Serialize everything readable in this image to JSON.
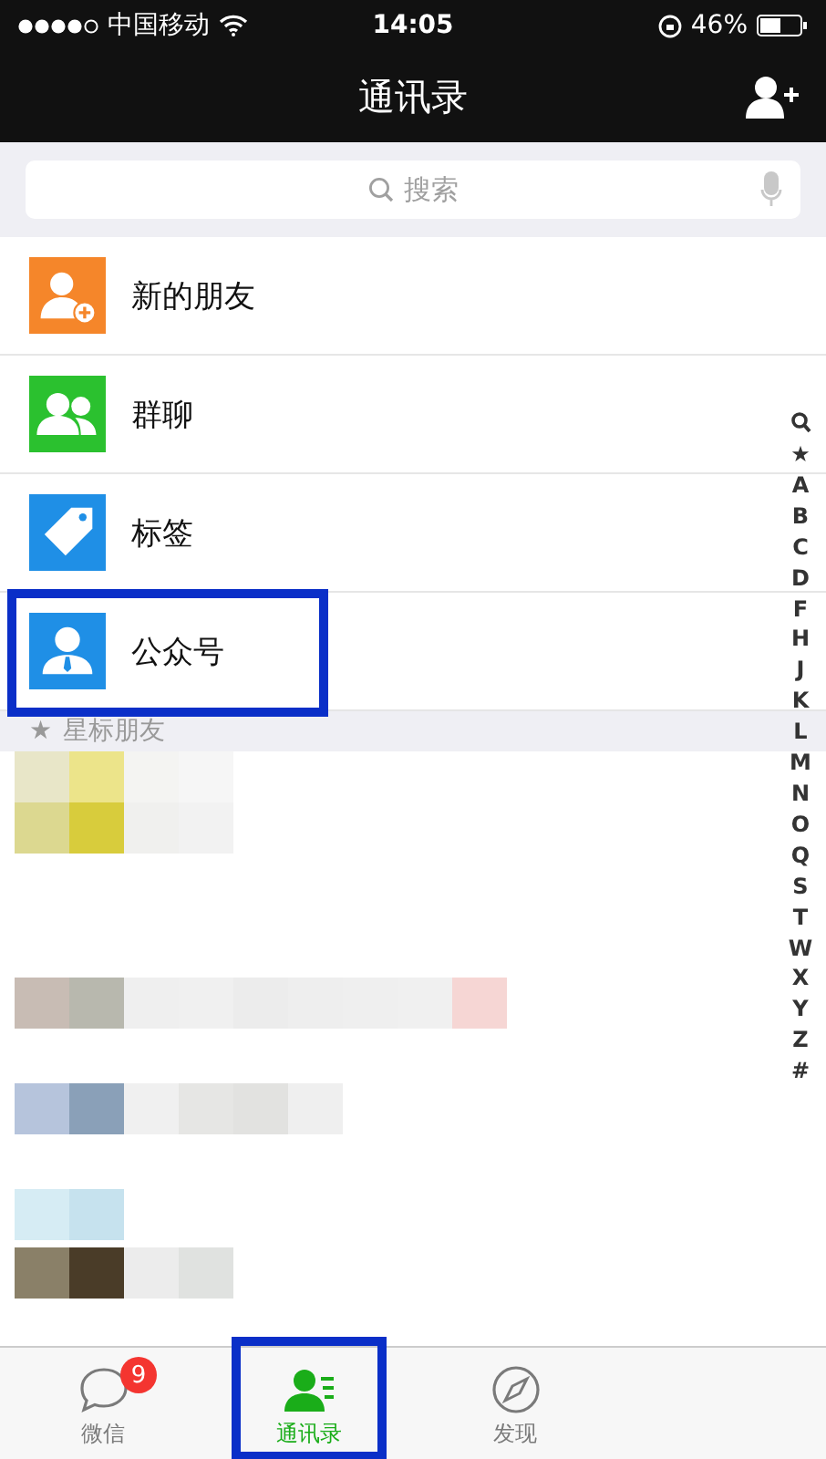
{
  "status_bar": {
    "carrier": "中国移动",
    "time": "14:05",
    "battery": "46%"
  },
  "nav": {
    "title": "通讯录"
  },
  "search": {
    "placeholder": "搜索"
  },
  "entries": [
    {
      "label": "新的朋友",
      "kind": "new-friends",
      "highlighted": false
    },
    {
      "label": "群聊",
      "kind": "group-chat",
      "highlighted": false
    },
    {
      "label": "标签",
      "kind": "tags",
      "highlighted": false
    },
    {
      "label": "公众号",
      "kind": "official",
      "highlighted": true
    }
  ],
  "section_header": {
    "star": "★",
    "label": "星标朋友"
  },
  "index": [
    "★",
    "A",
    "B",
    "C",
    "D",
    "F",
    "H",
    "J",
    "K",
    "L",
    "M",
    "N",
    "O",
    "Q",
    "S",
    "T",
    "W",
    "X",
    "Y",
    "Z",
    "#"
  ],
  "tabs": [
    {
      "label": "微信",
      "kind": "chats",
      "badge": "9",
      "selected": false,
      "highlighted": false
    },
    {
      "label": "通讯录",
      "kind": "contacts",
      "selected": true,
      "highlighted": true
    },
    {
      "label": "发现",
      "kind": "discover",
      "selected": false,
      "highlighted": false
    }
  ]
}
